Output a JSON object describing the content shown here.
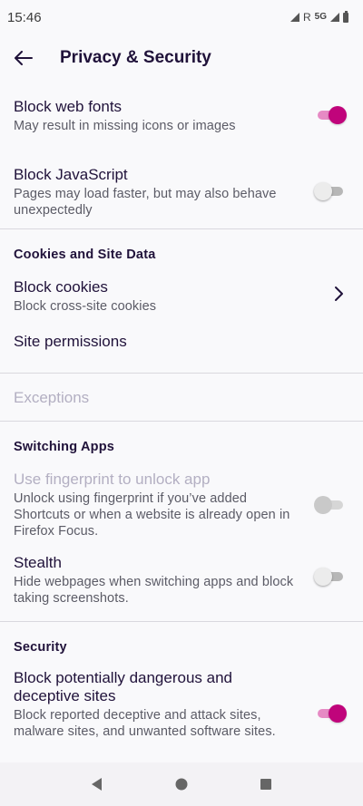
{
  "status_bar": {
    "time": "15:46",
    "roaming": "R",
    "network": "5G"
  },
  "toolbar": {
    "title": "Privacy & Security",
    "back_icon": "arrow-left-icon"
  },
  "items": {
    "web_fonts": {
      "title": "Block web fonts",
      "subtitle": "May result in missing icons or images",
      "enabled": true
    },
    "javascript": {
      "title": "Block JavaScript",
      "subtitle": "Pages may load faster, but may also behave unexpectedly",
      "enabled": false
    },
    "cookies_header": "Cookies and Site Data",
    "block_cookies": {
      "title": "Block cookies",
      "subtitle": "Block cross-site cookies"
    },
    "site_permissions": {
      "title": "Site permissions"
    },
    "exceptions": {
      "title": "Exceptions"
    },
    "switching_header": "Switching Apps",
    "fingerprint": {
      "title": "Use fingerprint to unlock app",
      "subtitle": "Unlock using fingerprint if you’ve added Shortcuts or when a website is already open in Firefox Focus.",
      "enabled": false
    },
    "stealth": {
      "title": "Stealth",
      "subtitle": "Hide webpages when switching apps and block taking screenshots.",
      "enabled": false
    },
    "security_header": "Security",
    "dangerous_sites": {
      "title": "Block potentially dangerous and deceptive sites",
      "subtitle": "Block reported deceptive and attack sites, malware sites, and unwanted software sites.",
      "enabled": true
    }
  },
  "nav_bar": {
    "back": "triangle-back-icon",
    "home": "circle-home-icon",
    "recents": "square-recents-icon"
  },
  "colors": {
    "accent": "#c0047b",
    "accent_track": "#e68ac4",
    "text": "#20123a",
    "subtext": "#5b5b66",
    "disabled": "#b3afc2"
  }
}
